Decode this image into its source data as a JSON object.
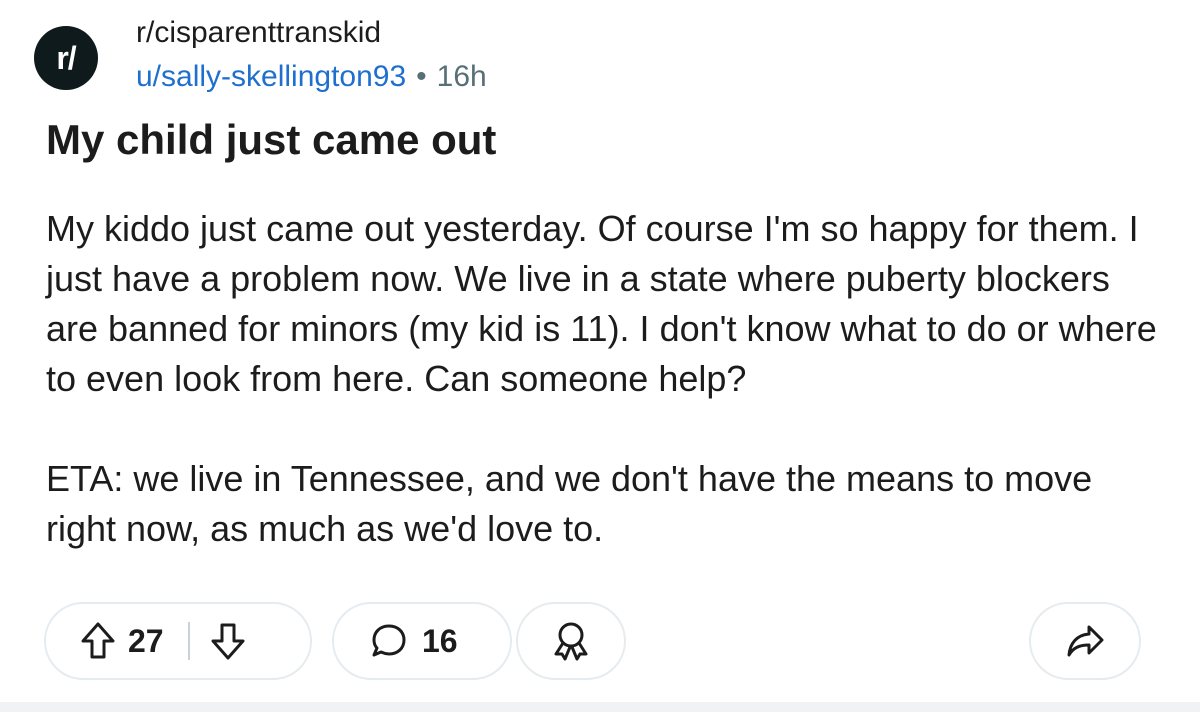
{
  "community": {
    "avatar_text": "r/",
    "name": "r/cisparenttranskid"
  },
  "author": {
    "username": "u/sally-skellington93",
    "separator": "•",
    "time": "16h"
  },
  "post": {
    "title": "My child just came out",
    "paragraphs": [
      "My kiddo just came out yesterday. Of course I'm so happy for them. I just have a problem now. We live in a state where puberty blockers are banned for minors (my kid is 11). I don't know what to do or where to even look from here. Can someone help?",
      "ETA: we live in Tennessee, and we don't have the means to move right now, as much as we'd love to."
    ]
  },
  "actions": {
    "upvote_icon": "upvote-arrow-icon",
    "score": "27",
    "downvote_icon": "downvote-arrow-icon",
    "comment_icon": "speech-bubble-icon",
    "comments": "16",
    "award_icon": "award-ribbon-icon",
    "share_icon": "share-arrow-icon"
  }
}
